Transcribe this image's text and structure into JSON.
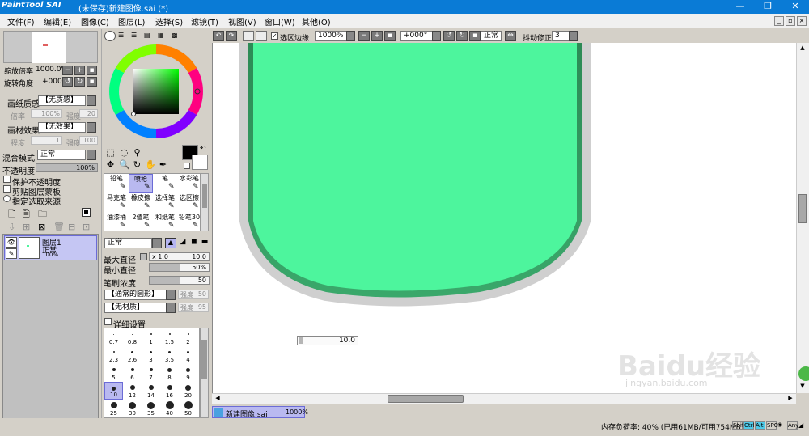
{
  "window": {
    "app_logo_text": "PaintTool SAI",
    "title": "(未保存)新建图像.sai (*)",
    "minimize": "—",
    "restore": "❐",
    "close": "✕"
  },
  "menu": [
    "文件(F)",
    "编辑(E)",
    "图像(C)",
    "图层(L)",
    "选择(S)",
    "滤镜(T)",
    "视图(V)",
    "窗口(W)",
    "其他(O)"
  ],
  "navigator": {
    "zoom_label": "缩放倍率",
    "zoom_value": "1000.0%",
    "rotate_label": "旋转角度",
    "rotate_value": "+000"
  },
  "layer_props": {
    "paper_texture_label": "画纸质感",
    "paper_texture_value": "【无质感】",
    "scale_label": "倍率",
    "scale_value": "100%",
    "strength_label": "强度",
    "strength_value": "20",
    "material_label": "画材效果",
    "material_value": "【无效果】",
    "degree_label": "程度",
    "degree_value": "1",
    "degree_strength_value": "100",
    "blend_label": "混合模式",
    "blend_value": "正常",
    "opacity_label": "不透明度",
    "opacity_value": "100%",
    "opacity_fraction": 1.0,
    "protect_opacity": "保护不透明度",
    "clip_mask": "剪贴图层蒙板",
    "selection_source": "指定选取来源"
  },
  "layers": [
    {
      "name": "图层1",
      "mode": "正常",
      "opacity": "100%"
    }
  ],
  "tools": {
    "brushes": [
      [
        "铅笔",
        "喷枪",
        "笔",
        "水彩笔"
      ],
      [
        "马克笔",
        "橡皮擦",
        "选择笔",
        "选区擦"
      ],
      [
        "油漆桶",
        "2值笔",
        "和纸笔",
        "铅笔30"
      ]
    ],
    "selected_brush": "喷枪",
    "mode_value": "正常",
    "max_diameter_label": "最大直径",
    "max_diameter_mult": "x 1.0",
    "max_diameter_value": "10.0",
    "min_diameter_label": "最小直径",
    "min_diameter_value": "50%",
    "min_diameter_fraction": 0.5,
    "density_label": "笔刷浓度",
    "density_value": "50",
    "density_fraction": 0.5,
    "shape_value": "【通常的圆形】",
    "shape_strength": "强度",
    "shape_strength_value": "50",
    "texture_value": "【无材质】",
    "texture_strength": "强度",
    "texture_strength_value": "95",
    "advanced_label": "详细设置",
    "brush_sizes": [
      "0.7",
      "0.8",
      "1",
      "1.5",
      "2",
      "2.3",
      "2.6",
      "3",
      "3.5",
      "4",
      "5",
      "6",
      "7",
      "8",
      "9",
      "10",
      "12",
      "14",
      "16",
      "20",
      "25",
      "30",
      "35",
      "40",
      "50"
    ],
    "selected_size": "10"
  },
  "toolbar": {
    "selection_edge_label": "选区边缘",
    "zoom_value": "1000%",
    "rotate_value": "+000°",
    "mode_value": "正常",
    "stabilizer_label": "抖动修正",
    "stabilizer_value": "3"
  },
  "canvas": {
    "size_readout": "10.0",
    "fill_color": "#4df59d"
  },
  "tabs": [
    {
      "label": "新建图像.sai",
      "zoom": "1000%"
    }
  ],
  "status": {
    "memory": "内存负荷率: 40% (已用61MB/可用754MB)",
    "keys": [
      "Shift",
      "Ctrl",
      "Alt",
      "SPC",
      "Any"
    ]
  },
  "watermark": {
    "text": "Baidu经验",
    "url": "jingyan.baidu.com"
  }
}
